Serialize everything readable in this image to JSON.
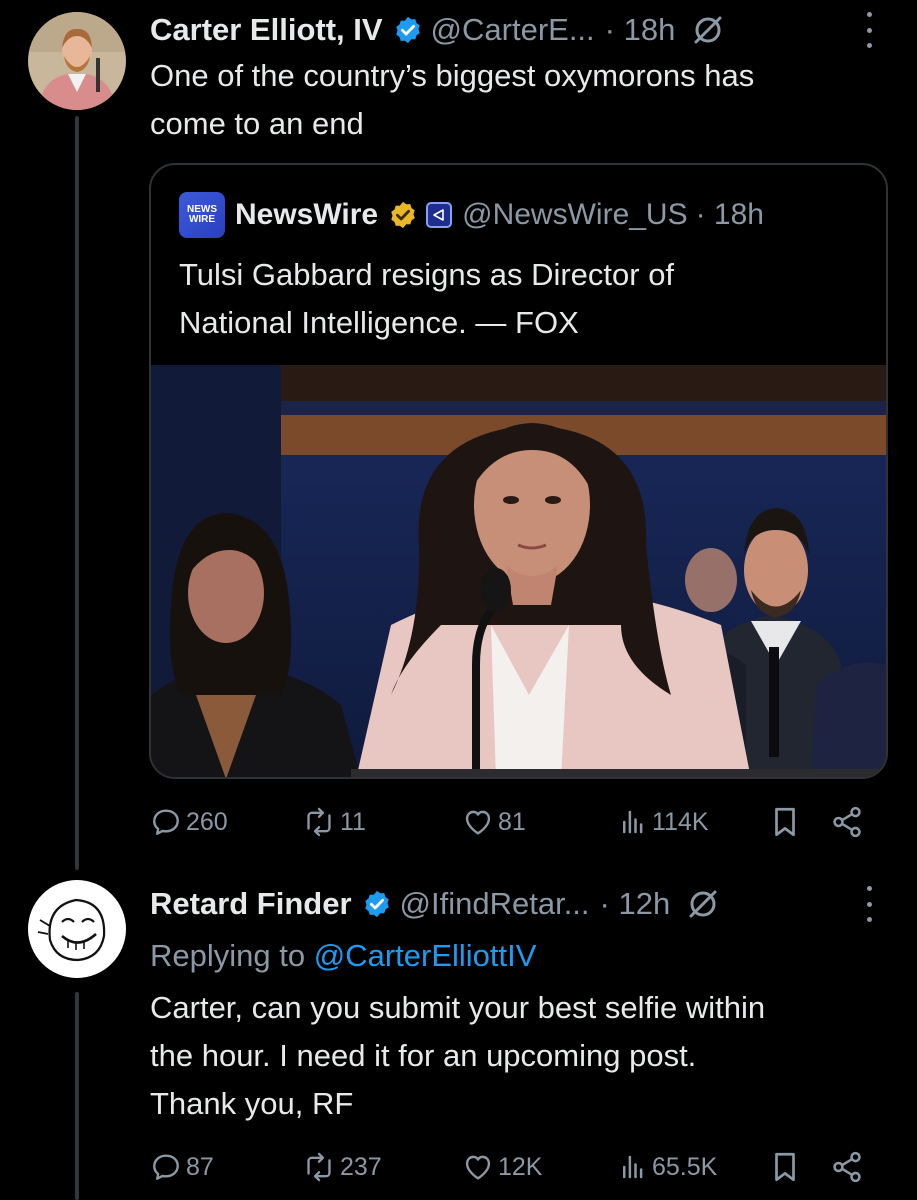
{
  "tweet1": {
    "display_name": "Carter Elliott, IV",
    "handle": "@CarterE...",
    "time": "· 18h",
    "text_line1": "One of the country’s biggest oxymorons has",
    "text_line2": "come to an end",
    "quote": {
      "logo_line1": "NEWS",
      "logo_line2": "WIRE",
      "display_name": "NewsWire",
      "handle": "@NewsWire_US",
      "time": "· 18h",
      "text_line1": "Tulsi Gabbard resigns as Director of",
      "text_line2": "National Intelligence. — FOX"
    },
    "stats": {
      "replies": "260",
      "reposts": "11",
      "likes": "81",
      "views": "114K"
    }
  },
  "tweet2": {
    "display_name": "Retard Finder",
    "handle": "@IfindRetar...",
    "time": "· 12h",
    "replying_prefix": "Replying to",
    "replying_to": "@CarterElliottIV",
    "text_line1": "Carter, can you submit your best selfie within",
    "text_line2": "the hour. I need it for an upcoming post.",
    "text_line3": "Thank you, RF",
    "stats": {
      "replies": "87",
      "reposts": "237",
      "likes": "12K",
      "views": "65.5K"
    }
  },
  "colors": {
    "background": "#000000",
    "text": "#e7e9ea",
    "muted": "#8b98a5",
    "link": "#1d9bf0",
    "verified_blue": "#1d9bf0",
    "verified_gold": "#e8b829"
  },
  "icons": [
    "verified-badge-icon",
    "grok-slash-icon",
    "more-icon",
    "reply-icon",
    "repost-icon",
    "like-icon",
    "views-icon",
    "bookmark-icon",
    "share-icon"
  ]
}
